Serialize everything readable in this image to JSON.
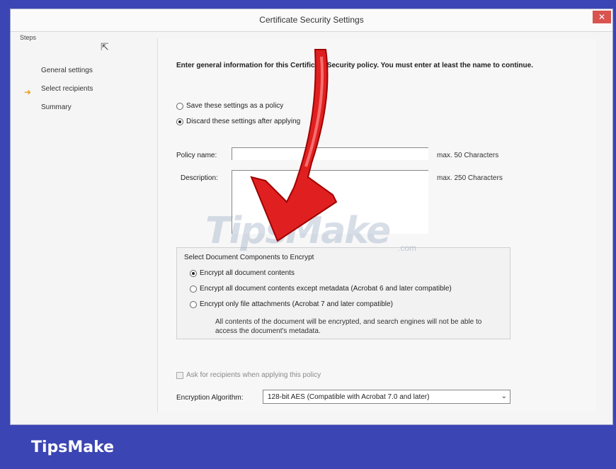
{
  "window": {
    "title": "Certificate Security Settings",
    "close_glyph": "✕"
  },
  "steps": {
    "title": "Steps",
    "items": [
      {
        "label": "General settings",
        "current": true
      },
      {
        "label": "Select recipients",
        "current": false
      },
      {
        "label": "Summary",
        "current": false
      }
    ]
  },
  "main": {
    "intro": "Enter general information for this Certificate Security policy. You must enter at least the name to continue.",
    "policy_options": [
      {
        "label": "Save these settings as a policy",
        "checked": false
      },
      {
        "label": "Discard these settings after applying",
        "checked": true
      }
    ],
    "policy_name": {
      "label": "Policy name:",
      "value": "",
      "limit": "max. 50 Characters"
    },
    "description": {
      "label": "Description:",
      "value": "",
      "limit": "max. 250 Characters"
    },
    "components": {
      "title": "Select Document Components to Encrypt",
      "options": [
        {
          "label": "Encrypt all document contents",
          "checked": true
        },
        {
          "label": "Encrypt all document contents except metadata (Acrobat 6 and later compatible)",
          "checked": false
        },
        {
          "label": "Encrypt only file attachments (Acrobat 7 and later compatible)",
          "checked": false
        }
      ],
      "note": "All contents of the document will be encrypted, and search engines will not be able to access the document's metadata."
    },
    "ask_recipients": {
      "label": "Ask for recipients when applying this policy",
      "checked": false,
      "disabled": true
    },
    "algorithm": {
      "label": "Encryption Algorithm:",
      "value": "128-bit AES (Compatible with Acrobat 7.0 and later)"
    }
  },
  "watermark": {
    "text": "TipsMake",
    "suffix": ".com"
  },
  "brand": {
    "text": "TipsMake"
  },
  "colors": {
    "frame": "#3c45b4",
    "arrow": "#e02020",
    "close": "#d9534f"
  }
}
